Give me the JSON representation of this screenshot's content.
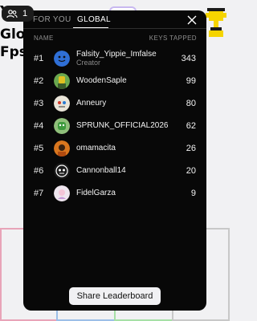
{
  "background": {
    "line1": "Y",
    "line2": "Glob",
    "line3": "Fps"
  },
  "users_chip": {
    "icon": "users-icon",
    "count": "1"
  },
  "panel": {
    "tabs": [
      {
        "label": "FOR YOU",
        "active": false
      },
      {
        "label": "GLOBAL",
        "active": true
      }
    ],
    "close_icon": "close-icon",
    "columns": {
      "name": "NAME",
      "keys": "KEYS TAPPED"
    },
    "rows": [
      {
        "rank": "#1",
        "name": "Falsity_Yippie_Imfalse",
        "subtitle": "Creator",
        "score": "343",
        "avatar_color": "#2f6fd6"
      },
      {
        "rank": "#2",
        "name": "WoodenSaple",
        "score": "99",
        "avatar_color": "#6aa84f"
      },
      {
        "rank": "#3",
        "name": "Anneury",
        "score": "80",
        "avatar_color": "#e9e4d8"
      },
      {
        "rank": "#4",
        "name": "SPRUNK_OFFICIAL2026",
        "score": "62",
        "avatar_color": "#8fbf7a"
      },
      {
        "rank": "#5",
        "name": "omamacita",
        "score": "26",
        "avatar_color": "#d9761e"
      },
      {
        "rank": "#6",
        "name": "Cannonball14",
        "score": "20",
        "avatar_color": "#1a1a1a"
      },
      {
        "rank": "#7",
        "name": "FidelGarza",
        "score": "9",
        "avatar_color": "#efe6ef"
      }
    ],
    "share_label": "Share Leaderboard"
  },
  "colors": {
    "panel_bg": "#080808",
    "accent": "#ffffff"
  }
}
